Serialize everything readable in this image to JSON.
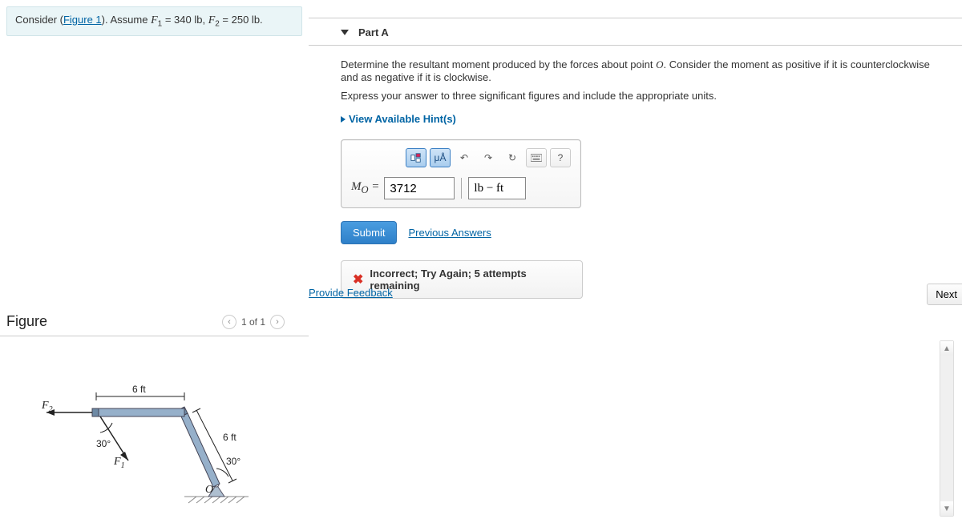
{
  "problem": {
    "prefix": "Consider (",
    "figure_link": "Figure 1",
    "mid": "). Assume ",
    "f1_label": "F",
    "f1_sub": "1",
    "f1_eq": " = 340 lb, ",
    "f2_label": "F",
    "f2_sub": "2",
    "f2_eq": " = 250 lb."
  },
  "part": {
    "title": "Part A",
    "prompt1_a": "Determine the resultant moment produced by the forces about point ",
    "prompt1_var": "O",
    "prompt1_b": ". Consider the moment as positive if it is counterclockwise and as negative if it is clockwise.",
    "prompt2": "Express your answer to three significant figures and include the appropriate units.",
    "hints": "View Available Hint(s)"
  },
  "toolbar": {
    "templates_icon": "templates",
    "units_label": "μÅ",
    "undo_icon": "↶",
    "redo_icon": "↷",
    "reset_icon": "↻",
    "keyboard_icon": "⌨",
    "help_icon": "?"
  },
  "answer": {
    "lhs_sym": "M",
    "lhs_sub": "O",
    "eq": " = ",
    "value": "3712",
    "units": "lb − ft"
  },
  "actions": {
    "submit": "Submit",
    "previous": "Previous Answers"
  },
  "feedback": {
    "icon": "✖",
    "message": "Incorrect; Try Again; 5 attempts remaining"
  },
  "footer": {
    "provide": "Provide Feedback",
    "next": "Next"
  },
  "figure": {
    "title": "Figure",
    "nav_text": "1 of 1",
    "dim_top": "6 ft",
    "dim_right": "6 ft",
    "f2_label": "F",
    "f2_sub": "2",
    "f1_label": "F",
    "f1_sub": "1",
    "ang1": "30°",
    "ang2": "30°",
    "o_label": "O"
  }
}
